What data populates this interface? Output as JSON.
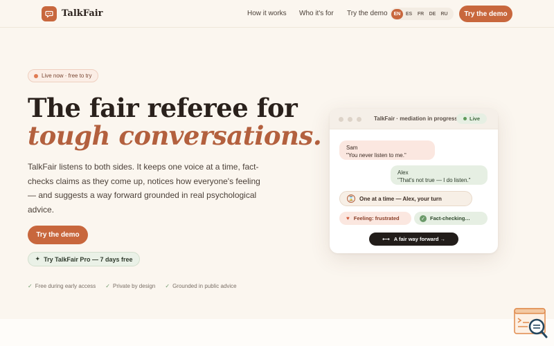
{
  "brand": {
    "name": "TalkFair",
    "logo_icon": "chat-bubble-icon",
    "accent": "#c8673d"
  },
  "nav": {
    "links": [
      "How it works",
      "Who it's for",
      "Try the demo"
    ],
    "languages": [
      "EN",
      "ES",
      "FR",
      "DE",
      "RU"
    ],
    "active_language": "EN",
    "cta": "Try the demo"
  },
  "hero": {
    "badge": "Live now · free to try",
    "title_line1": "The fair referee for",
    "title_line2": "tough conversations.",
    "description": "TalkFair listens to both sides. It keeps one voice at a time, fact-checks claims as they come up, notices how everyone's feeling — and suggests a way forward grounded in real psychological advice.",
    "primary_cta": "Try the demo",
    "pro_cta": "Try TalkFair Pro — 7 days free",
    "features": [
      "Free during early access",
      "Private by design",
      "Grounded in public advice"
    ]
  },
  "mock": {
    "title": "TalkFair · mediation in progress",
    "live_label": "Live",
    "messages": [
      {
        "name": "Sam",
        "text": "\"You never listen to me.\""
      },
      {
        "name": "Alex",
        "text": "\"That's not true — I do listen.\""
      }
    ],
    "turn_label": "One at a time — Alex, your turn",
    "feeling_label": "Feeling: frustrated",
    "fact_label": "Fact-checking…",
    "forward_label": "A fair way forward →"
  }
}
